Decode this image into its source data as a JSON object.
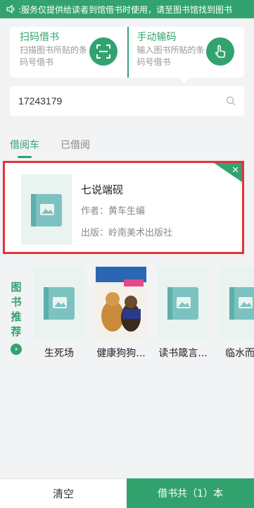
{
  "notice": {
    "text": ":服务仅提供给读者到馆借书时使用，请至图书馆找到图书",
    "icon": "speaker-icon"
  },
  "scan": {
    "title": "扫码借书",
    "desc": "扫描图书所贴的条码号借书",
    "icon": "scan-icon"
  },
  "manual": {
    "title": "手动输码",
    "desc": "输入图书所贴的条码号借书",
    "icon": "tap-hand-icon"
  },
  "search": {
    "value": "17243179",
    "icon": "search-icon"
  },
  "tabs": [
    {
      "label": "借阅车",
      "active": true
    },
    {
      "label": "已借阅",
      "active": false
    }
  ],
  "cart_book": {
    "title": "七说端砚",
    "author": "作者：黄车生编",
    "publisher": "出版：岭南美术出版社",
    "remove_label": "✕"
  },
  "recommend": {
    "chars": [
      "图",
      "书",
      "推",
      "荐"
    ],
    "go_label": "›",
    "items": [
      {
        "name": "生死场",
        "cover": "placeholder"
      },
      {
        "name": "健康狗狗...",
        "cover": "dog"
      },
      {
        "name": "读书箴言...",
        "cover": "placeholder"
      },
      {
        "name": "临水而居",
        "cover": "placeholder"
      }
    ]
  },
  "bottom": {
    "clear_label": "清空",
    "borrow_label": "借书共（1）本"
  },
  "colors": {
    "primary": "#32a36f",
    "highlight": "#e4323b",
    "background": "#f2f3f5"
  }
}
